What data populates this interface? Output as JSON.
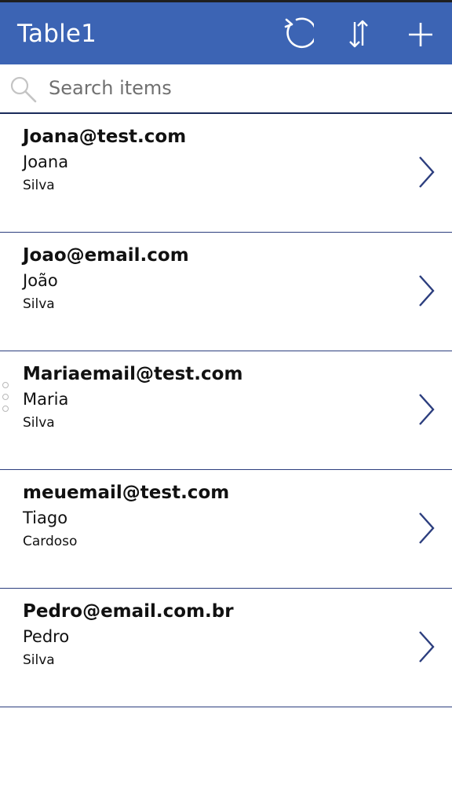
{
  "app": {
    "title": "Table1",
    "icons": {
      "refresh": "refresh-icon",
      "sort": "sort-icon",
      "add": "add-icon",
      "search": "search-icon",
      "chevron": "chevron-right-icon"
    },
    "colors": {
      "header_bg": "#3c64b4",
      "divider": "#2c3e7e",
      "chevron": "#2c3e7e"
    }
  },
  "search": {
    "placeholder": "Search items",
    "value": ""
  },
  "items": [
    {
      "email": "Joana@test.com",
      "first_name": "Joana",
      "last_name": "Silva"
    },
    {
      "email": "Joao@email.com",
      "first_name": "João",
      "last_name": "Silva"
    },
    {
      "email": "Mariaemail@test.com",
      "first_name": "Maria",
      "last_name": "Silva"
    },
    {
      "email": "meuemail@test.com",
      "first_name": "Tiago",
      "last_name": "Cardoso"
    },
    {
      "email": "Pedro@email.com.br",
      "first_name": "Pedro",
      "last_name": "Silva"
    }
  ]
}
